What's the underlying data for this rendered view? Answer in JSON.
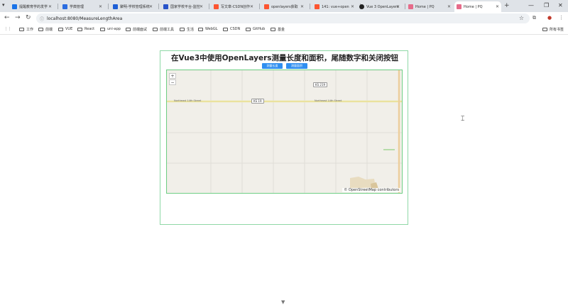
{
  "browser": {
    "tabs": [
      {
        "label": "提醒教育学的发学",
        "color": "#1a73e8"
      },
      {
        "label": "学典管理",
        "color": "#2b6de0"
      },
      {
        "label": "聚明-学校管理系统",
        "color": "#1d5fd6"
      },
      {
        "label": "国家学校平台-监控",
        "color": "#2753c9"
      },
      {
        "label": "写文章-CSDN创作",
        "color": "#fc5531"
      },
      {
        "label": "openlayers获取",
        "color": "#fc5531"
      },
      {
        "label": "141: vue+open",
        "color": "#fc5531"
      },
      {
        "label": "Vue 3 OpenLayers",
        "color": "#222222"
      },
      {
        "label": "Home | PQ",
        "color": "#e66b8a"
      },
      {
        "label": "Home | PQ",
        "color": "#e66b8a"
      }
    ],
    "url": "localhost:8080/MeasureLengthArea",
    "bookmarks": [
      "工作",
      "前端",
      "VUE",
      "React",
      "uni-app",
      "前端面试",
      "前端工具",
      "生活",
      "WebGL",
      "CSDN",
      "GitHub",
      "基金"
    ],
    "all_bookmarks": "所有书签"
  },
  "page": {
    "title": "在Vue3中使用OpenLayers测量长度和面积，尾随数字和关闭按钮",
    "buttons": {
      "measure_length": "测量长度",
      "measure_area": "测量面积"
    }
  },
  "map": {
    "zoom_in": "+",
    "zoom_out": "−",
    "road_labels": {
      "north_left": "Northeast 14th Street",
      "north_right": "Northeast 14th Street"
    },
    "shields": {
      "ks219": "KS 219",
      "ks19": "KS 19"
    },
    "attribution": "© OpenStreetMap contributors"
  }
}
